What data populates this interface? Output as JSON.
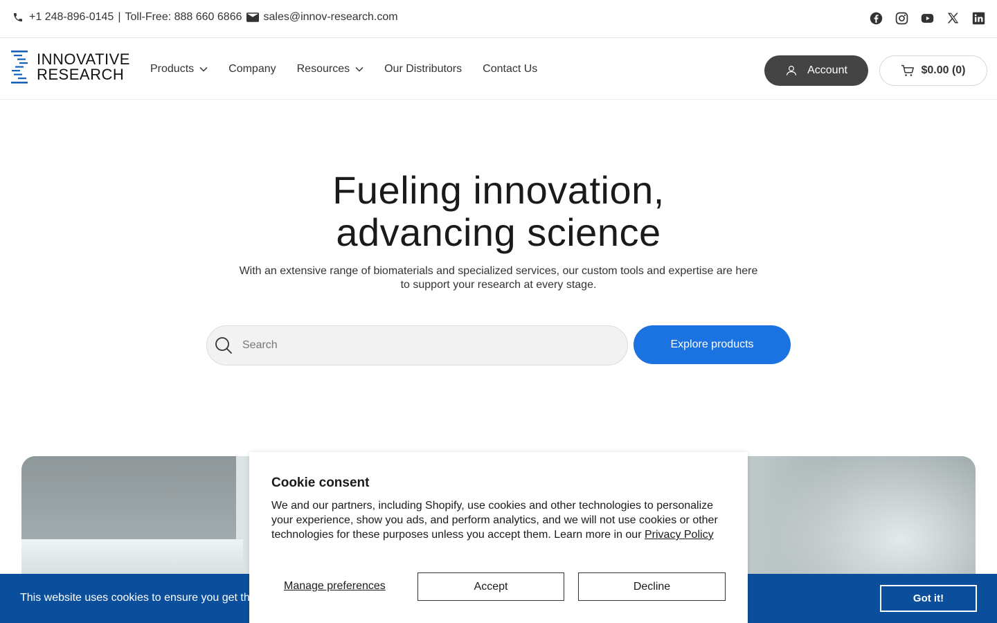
{
  "topbar": {
    "phone": "+1 248-896-0145",
    "separator": "|",
    "tollfree": "Toll-Free: 888 660 6866",
    "email": "sales@innov-research.com",
    "icons": [
      "phone-icon",
      "mail-icon"
    ],
    "socials": [
      "facebook-icon",
      "instagram-icon",
      "youtube-icon",
      "x-icon",
      "linkedin-icon"
    ]
  },
  "header": {
    "logo_line1": "INNOVATIVE",
    "logo_line2": "RESEARCH",
    "nav": [
      {
        "label": "Products",
        "dropdown": true
      },
      {
        "label": "Company",
        "dropdown": false
      },
      {
        "label": "Resources",
        "dropdown": true
      },
      {
        "label": "Our Distributors",
        "dropdown": false
      },
      {
        "label": "Contact Us",
        "dropdown": false
      }
    ],
    "account_label": "Account",
    "cart_label": "$0.00 (0)"
  },
  "hero": {
    "title_line1": "Fueling innovation,",
    "title_line2": "advancing science",
    "subtitle": "With an extensive range of biomaterials and specialized services, our custom tools and expertise are here to support your research at every stage.",
    "search_placeholder": "Search",
    "explore_label": "Explore products"
  },
  "cookie_bar": {
    "message": "This website uses cookies to ensure you get th",
    "button": "Got it!"
  },
  "consent": {
    "title": "Cookie consent",
    "body": "We and our partners, including Shopify, use cookies and other technologies to personalize your experience, show you ads, and perform analytics, and we will not use cookies or other technologies for these purposes unless you accept them. Learn more in our",
    "link": "Privacy Policy",
    "manage": "Manage preferences",
    "accept": "Accept",
    "decline": "Decline"
  },
  "colors": {
    "brand_blue": "#1a73e1",
    "cookie_bar": "#0b4f9c",
    "account_button": "#444444",
    "logo_blue": "#1560b8"
  }
}
